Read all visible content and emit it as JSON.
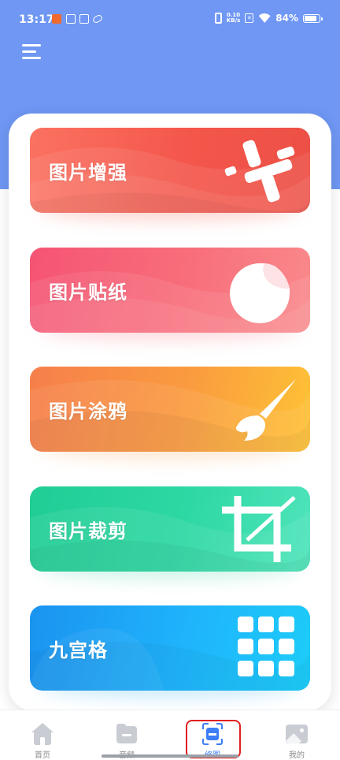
{
  "status_bar": {
    "time": "13:17",
    "notification_icons": [
      "app-notification-icon-1",
      "app-notification-icon-2",
      "app-notification-icon-3",
      "app-notification-icon-4"
    ],
    "net_speed_value": "0.10",
    "net_speed_unit": "KB/s",
    "battery_percent": "84%",
    "battery_level": 0.84
  },
  "header": {
    "menu_icon": "hamburger-menu-icon",
    "background_color": "#6f97f3"
  },
  "cards": [
    {
      "title": "图片增强",
      "icon": "enhance-sliders-icon",
      "colors": [
        "#fb7261",
        "#ec4f45"
      ]
    },
    {
      "title": "图片贴纸",
      "icon": "sticker-peel-icon",
      "colors": [
        "#f55473",
        "#f98a8c"
      ]
    },
    {
      "title": "图片涂鸦",
      "icon": "paint-brush-icon",
      "colors": [
        "#f67f4b",
        "#fec236"
      ]
    },
    {
      "title": "图片裁剪",
      "icon": "crop-icon",
      "colors": [
        "#20cd95",
        "#4fe4bb"
      ]
    },
    {
      "title": "九宫格",
      "icon": "nine-grid-icon",
      "colors": [
        "#1b93f0",
        "#1dccf8"
      ]
    }
  ],
  "tab_bar": {
    "active_tab": "修图",
    "active_color": "#3d7ef5",
    "tabs": [
      {
        "label": "首页",
        "icon": "home-icon"
      },
      {
        "label": "音频",
        "icon": "folder-icon"
      },
      {
        "label": "修图",
        "icon": "scan-edit-icon"
      },
      {
        "label": "我的",
        "icon": "picture-icon"
      }
    ]
  }
}
